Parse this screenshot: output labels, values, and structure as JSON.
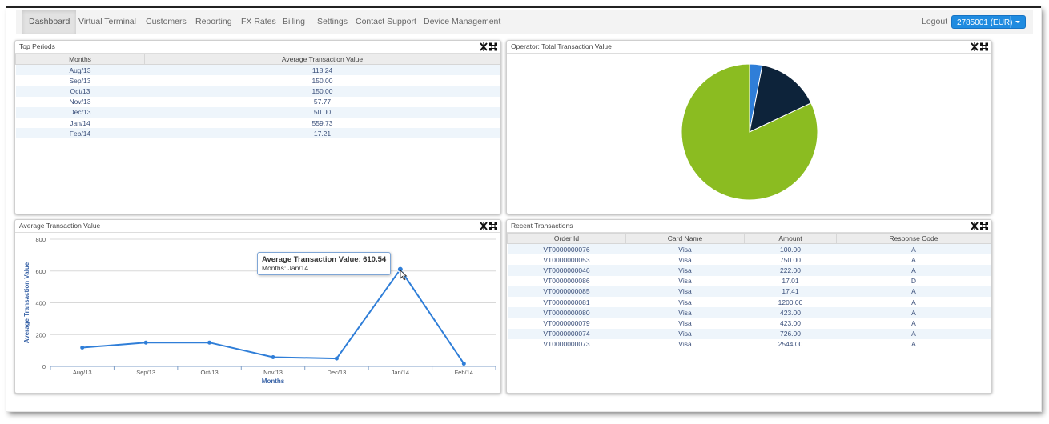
{
  "nav": {
    "items": [
      "Dashboard",
      "Virtual Terminal",
      "Customers",
      "Reporting",
      "FX Rates",
      "Billing",
      "Settings",
      "Contact Support",
      "Device Management"
    ],
    "active": "Dashboard",
    "logout_label": "Logout",
    "account_label": "2785001 (EUR)"
  },
  "colors": {
    "accent": "#1f8be0",
    "series": "#2f7ed8",
    "pie_green": "#8bbc21",
    "pie_navy": "#0d233a",
    "pie_blue": "#2f7ed8"
  },
  "top_periods": {
    "title": "Top Periods",
    "columns": [
      "Months",
      "Average Transaction Value"
    ],
    "rows": [
      [
        "Aug/13",
        "118.24"
      ],
      [
        "Sep/13",
        "150.00"
      ],
      [
        "Oct/13",
        "150.00"
      ],
      [
        "Nov/13",
        "57.77"
      ],
      [
        "Dec/13",
        "50.00"
      ],
      [
        "Jan/14",
        "559.73"
      ],
      [
        "Feb/14",
        "17.21"
      ]
    ]
  },
  "operator_panel": {
    "title": "Operator: Total Transaction Value"
  },
  "avg_panel": {
    "title": "Average Transaction Value"
  },
  "recent": {
    "title": "Recent Transactions",
    "columns": [
      "Order Id",
      "Card Name",
      "Amount",
      "Response Code"
    ],
    "rows": [
      [
        "VT0000000076",
        "Visa",
        "100.00",
        "A"
      ],
      [
        "VT0000000053",
        "Visa",
        "750.00",
        "A"
      ],
      [
        "VT0000000046",
        "Visa",
        "222.00",
        "A"
      ],
      [
        "VT0000000086",
        "Visa",
        "17.01",
        "D"
      ],
      [
        "VT0000000085",
        "Visa",
        "17.41",
        "A"
      ],
      [
        "VT0000000081",
        "Visa",
        "1200.00",
        "A"
      ],
      [
        "VT0000000080",
        "Visa",
        "423.00",
        "A"
      ],
      [
        "VT0000000079",
        "Visa",
        "423.00",
        "A"
      ],
      [
        "VT0000000074",
        "Visa",
        "726.00",
        "A"
      ],
      [
        "VT0000000073",
        "Visa",
        "2544.00",
        "A"
      ]
    ]
  },
  "tooltip": {
    "label": "Average Transaction Value:",
    "value": "610.54",
    "sub": "Months: Jan/14"
  },
  "chart_data": [
    {
      "type": "pie",
      "slices": [
        {
          "value": 3,
          "color": "#2f7ed8"
        },
        {
          "value": 15,
          "color": "#0d233a"
        },
        {
          "value": 82,
          "color": "#8bbc21"
        }
      ]
    },
    {
      "type": "line",
      "categories": [
        "Aug/13",
        "Sep/13",
        "Oct/13",
        "Nov/13",
        "Dec/13",
        "Jan/14",
        "Feb/14"
      ],
      "values": [
        118.24,
        150.0,
        150.0,
        57.77,
        50.0,
        610.54,
        17.21
      ],
      "xlabel": "Months",
      "ylabel": "Average Transaction Value",
      "ylim": [
        0,
        800
      ],
      "yticks": [
        0,
        200,
        400,
        600,
        800
      ],
      "highlighted_index": 5,
      "grid": true
    }
  ]
}
